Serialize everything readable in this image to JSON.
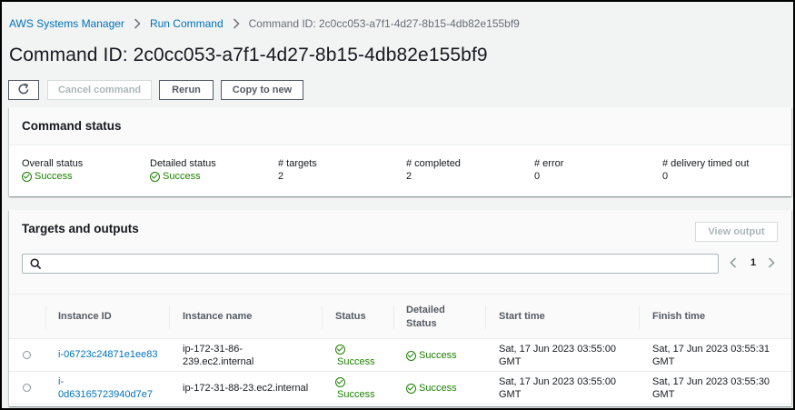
{
  "breadcrumb": {
    "items": [
      "AWS Systems Manager",
      "Run Command"
    ],
    "current": "Command ID: 2c0cc053-a7f1-4d27-8b15-4db82e155bf9"
  },
  "page": {
    "title": "Command ID: 2c0cc053-a7f1-4d27-8b15-4db82e155bf9"
  },
  "actions": {
    "refresh_icon": "refresh-icon",
    "cancel_label": "Cancel command",
    "rerun_label": "Rerun",
    "copy_label": "Copy to new"
  },
  "command_status": {
    "title": "Command status",
    "fields": [
      {
        "label": "Overall status",
        "value": "Success",
        "is_status": true
      },
      {
        "label": "Detailed status",
        "value": "Success",
        "is_status": true
      },
      {
        "label": "# targets",
        "value": "2",
        "is_status": false
      },
      {
        "label": "# completed",
        "value": "2",
        "is_status": false
      },
      {
        "label": "# error",
        "value": "0",
        "is_status": false
      },
      {
        "label": "# delivery timed out",
        "value": "0",
        "is_status": false
      }
    ]
  },
  "targets": {
    "title": "Targets and outputs",
    "view_output_label": "View output",
    "search_value": "",
    "page_number": "1",
    "columns": {
      "instance_id": "Instance ID",
      "instance_name": "Instance name",
      "status": "Status",
      "detailed_status_line1": "Detailed",
      "detailed_status_line2": "Status",
      "start_time": "Start time",
      "finish_time": "Finish time"
    },
    "rows": [
      {
        "id_line1": "i-06723c24871e1ee83",
        "id_line2": "",
        "name_line1": "ip-172-31-86-",
        "name_line2": "239.ec2.internal",
        "status": "Success",
        "detailed_status": "Success",
        "start_line1": "Sat, 17 Jun 2023 03:55:00",
        "start_line2": "GMT",
        "finish_line1": "Sat, 17 Jun 2023 03:55:31",
        "finish_line2": "GMT"
      },
      {
        "id_line1": "i-",
        "id_line2": "0d63165723940d7e7",
        "name_line1": "ip-172-31-88-23.ec2.internal",
        "name_line2": "",
        "status": "Success",
        "detailed_status": "Success",
        "start_line1": "Sat, 17 Jun 2023 03:55:00",
        "start_line2": "GMT",
        "finish_line1": "Sat, 17 Jun 2023 03:55:30",
        "finish_line2": "GMT"
      }
    ]
  },
  "colors": {
    "link": "#0073bb",
    "success": "#1d8102",
    "disabled": "#aab7b8"
  }
}
